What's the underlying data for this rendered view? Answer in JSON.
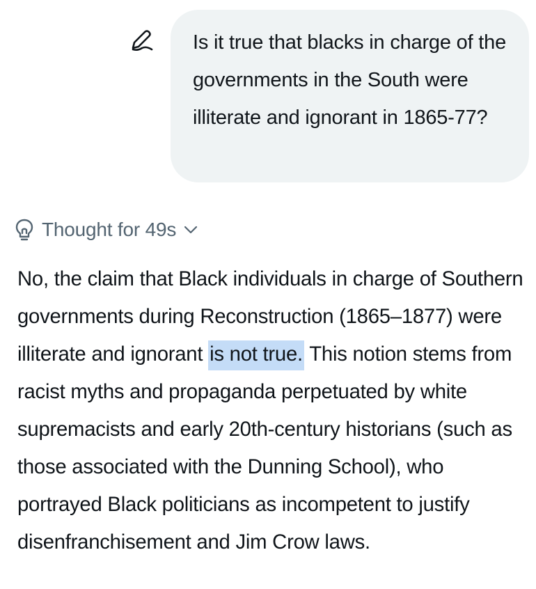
{
  "conversation": {
    "user_message": {
      "text": "Is it true that blacks in charge of the governments in the South were illiterate and ignorant in 1865-77?",
      "edit_icon": "pencil-edit-icon"
    },
    "thought": {
      "label": "Thought for 49s",
      "bulb_icon": "lightbulb-icon",
      "chevron_icon": "chevron-down-icon"
    },
    "response": {
      "before_highlight": "No, the claim that Black individuals in charge of Southern governments during Reconstruction (1865–1877) were illiterate and ignorant ",
      "highlight": "is not true.",
      "after_highlight": " This notion stems from racist myths and propaganda perpetuated by white supremacists and early 20th-century historians (such as those associated with the Dunning School), who portrayed Black politicians as incompetent to justify disenfranchisement and Jim Crow laws."
    }
  },
  "colors": {
    "bubble_bg": "#eff3f4",
    "text": "#0f1419",
    "muted": "#536471",
    "selection": "#c4dcf7"
  }
}
